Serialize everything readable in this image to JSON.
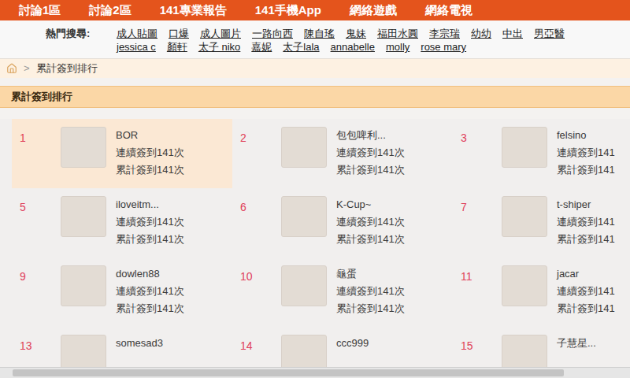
{
  "nav": {
    "items": [
      "討論1區",
      "討論2區",
      "141專業報告",
      "141手機App",
      "網絡遊戲",
      "網絡電視"
    ]
  },
  "hot_search": {
    "label": "熱門搜尋:",
    "rows": [
      [
        "成人貼圖",
        "口爆",
        "成人圖片",
        "一路向西",
        "陳自瑤",
        "鬼妹",
        "福田水圓",
        "李宗瑞",
        "幼幼",
        "中出",
        "男亞醫"
      ],
      [
        "jessica c",
        "顏軒",
        "太子 niko",
        "嘉妮",
        "太子lala",
        "annabelle",
        "molly",
        "rose mary"
      ]
    ]
  },
  "breadcrumb": {
    "separator": ">",
    "current": "累計簽到排行"
  },
  "section": {
    "title": "累計簽到排行"
  },
  "ranking": [
    {
      "rank": "1",
      "name": "BOR",
      "lines": [
        "連續簽到141次",
        "累計簽到141次"
      ],
      "selected": true
    },
    {
      "rank": "2",
      "name": "包包啤利...",
      "lines": [
        "連續簽到141次",
        "累計簽到141次"
      ],
      "selected": false
    },
    {
      "rank": "3",
      "name": "felsino",
      "lines": [
        "連續簽到141",
        "累計簽到141"
      ],
      "selected": false
    },
    {
      "rank": "5",
      "name": "iloveitm...",
      "lines": [
        "連續簽到141次",
        "累計簽到141次"
      ],
      "selected": false
    },
    {
      "rank": "6",
      "name": "K-Cup~",
      "lines": [
        "連續簽到141次",
        "累計簽到141次"
      ],
      "selected": false
    },
    {
      "rank": "7",
      "name": "t-shiper",
      "lines": [
        "連續簽到141",
        "累計簽到141"
      ],
      "selected": false
    },
    {
      "rank": "9",
      "name": "dowlen88",
      "lines": [
        "連續簽到141次",
        "累計簽到141次"
      ],
      "selected": false
    },
    {
      "rank": "10",
      "name": "龜蛋",
      "lines": [
        "連續簽到141次",
        "累計簽到141次"
      ],
      "selected": false
    },
    {
      "rank": "11",
      "name": "jacar",
      "lines": [
        "連續簽到141",
        "累計簽到141"
      ],
      "selected": false
    },
    {
      "rank": "13",
      "name": "somesad3",
      "lines": [],
      "selected": false
    },
    {
      "rank": "14",
      "name": "ccc999",
      "lines": [],
      "selected": false
    },
    {
      "rank": "15",
      "name": "子慧星...",
      "lines": [],
      "selected": false
    }
  ]
}
